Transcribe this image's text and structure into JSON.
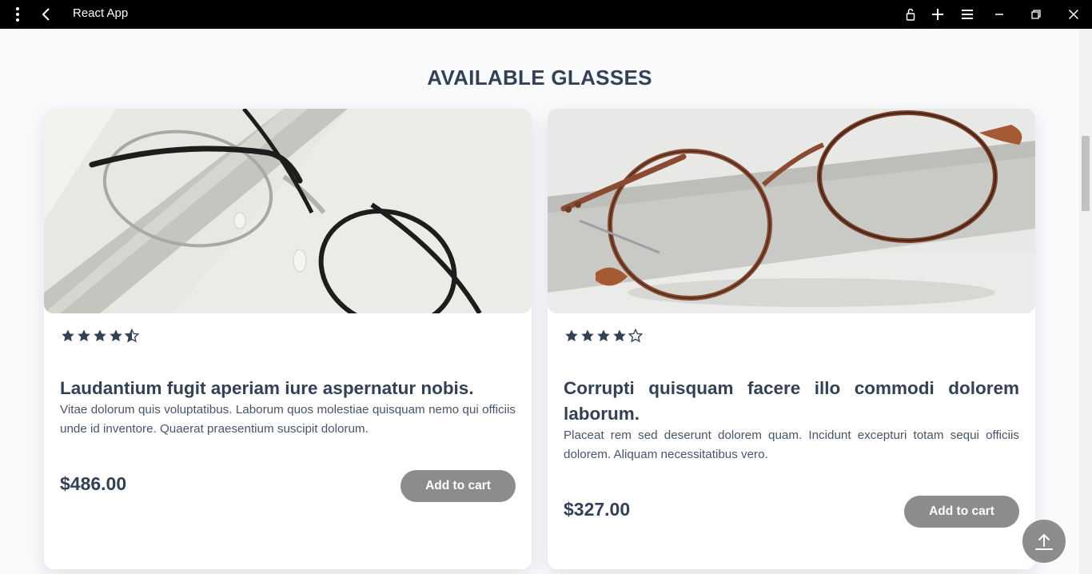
{
  "window": {
    "title": "React App",
    "icons": [
      "kebab-menu-icon",
      "back-arrow-icon",
      "lock-icon",
      "plus-icon",
      "hamburger-menu-icon",
      "minimize-icon",
      "restore-icon",
      "close-icon"
    ]
  },
  "page": {
    "heading": "AVAILABLE GLASSES"
  },
  "products": [
    {
      "rating": 4.5,
      "title": "Laudantium fugit aperiam iure aspernatur nobis.",
      "description": "Vitae dolorum quis voluptatibus. Laborum quos molestiae quisquam nemo qui officiis unde id inventore. Quaerat praesentium suscipit dolorum.",
      "price": "$486.00",
      "button_label": "Add to cart"
    },
    {
      "rating": 4,
      "title": "Corrupti quisquam facere illo commodi dolorem laborum.",
      "description": "Placeat rem sed deserunt dolorem quam. Incidunt excepturi totam sequi officiis dolorem. Aliquam necessitatibus vero.",
      "price": "$327.00",
      "button_label": "Add to cart"
    }
  ],
  "colors": {
    "text_dark": "#334155",
    "button_gray": "#8c8c8c",
    "titlebar": "#000000",
    "background": "#f8fafc"
  }
}
